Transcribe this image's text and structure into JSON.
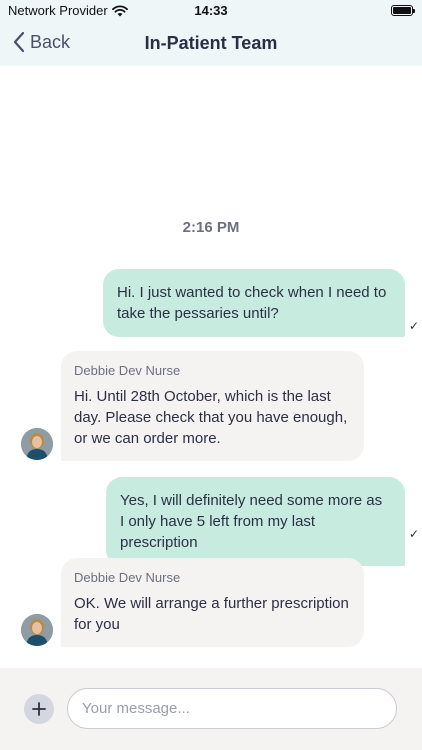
{
  "status_bar": {
    "carrier": "Network Provider",
    "time": "14:33",
    "icons": [
      "wifi-icon",
      "battery-icon"
    ]
  },
  "nav": {
    "back_label": "Back",
    "title": "In-Patient Team"
  },
  "chat": {
    "timestamp": "2:16 PM",
    "messages": [
      {
        "direction": "outgoing",
        "text": "Hi. I just wanted to check when I need to take the pessaries until?",
        "status": "✓"
      },
      {
        "direction": "incoming",
        "sender": "Debbie Dev Nurse",
        "text": "Hi. Until 28th October, which is the last day. Please check that you have enough, or we can order more."
      },
      {
        "direction": "outgoing",
        "text": "Yes, I will definitely need some more as I only have 5 left from my last prescription",
        "status": "✓"
      },
      {
        "direction": "incoming",
        "sender": "Debbie Dev Nurse",
        "text": "OK. We will arrange a further prescription for you"
      }
    ]
  },
  "composer": {
    "placeholder": "Your message...",
    "value": ""
  },
  "colors": {
    "header_bg": "#eef6f8",
    "outgoing_bubble": "#c8ebdf",
    "incoming_bubble": "#f5f3f2",
    "text_primary": "#2b2f45"
  }
}
